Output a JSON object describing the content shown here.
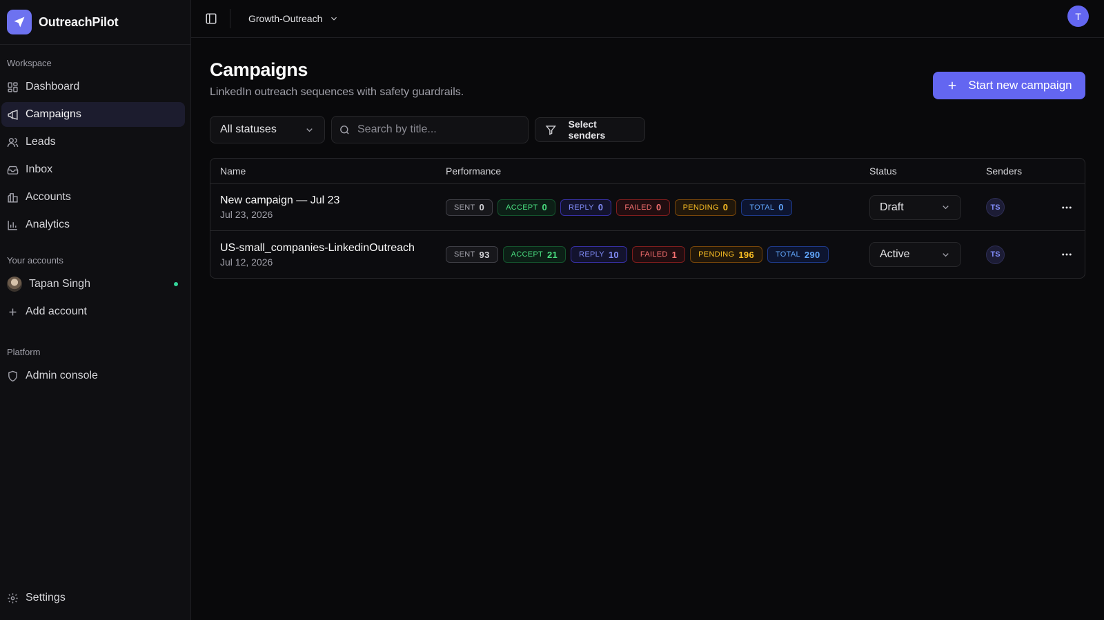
{
  "brand": {
    "name": "OutreachPilot"
  },
  "sidebar": {
    "workspace_label": "Workspace",
    "nav": [
      {
        "label": "Dashboard",
        "icon": "dashboard-icon"
      },
      {
        "label": "Campaigns",
        "icon": "megaphone-icon",
        "active": true
      },
      {
        "label": "Leads",
        "icon": "users-icon"
      },
      {
        "label": "Inbox",
        "icon": "inbox-icon"
      },
      {
        "label": "Accounts",
        "icon": "accounts-icon"
      },
      {
        "label": "Analytics",
        "icon": "bar-chart-icon"
      }
    ],
    "your_accounts_label": "Your accounts",
    "account": {
      "name": "Tapan Singh",
      "status": "online"
    },
    "add_account_label": "Add account",
    "platform_label": "Platform",
    "admin_label": "Admin console",
    "settings_label": "Settings"
  },
  "topbar": {
    "workspace": "Growth-Outreach",
    "user_initial": "T"
  },
  "page": {
    "title": "Campaigns",
    "subtitle": "LinkedIn outreach sequences with safety guardrails.",
    "new_button": "Start new campaign"
  },
  "filters": {
    "status": "All statuses",
    "search_placeholder": "Search by title...",
    "senders_button": "Select senders"
  },
  "table": {
    "headers": {
      "name": "Name",
      "performance": "Performance",
      "status": "Status",
      "senders": "Senders"
    },
    "metric_labels": {
      "sent": "SENT",
      "accept": "ACCEPT",
      "reply": "REPLY",
      "failed": "FAILED",
      "pending": "PENDING",
      "total": "TOTAL"
    },
    "rows": [
      {
        "title": "New campaign — Jul 23",
        "date": "Jul 23, 2026",
        "sent": "0",
        "accept": "0",
        "reply": "0",
        "failed": "0",
        "pending": "0",
        "total": "0",
        "status": "Draft",
        "sender": "TS"
      },
      {
        "title": "US-small_companies-LinkedinOutreach",
        "date": "Jul 12, 2026",
        "sent": "93",
        "accept": "21",
        "reply": "10",
        "failed": "1",
        "pending": "196",
        "total": "290",
        "status": "Active",
        "sender": "TS"
      }
    ]
  },
  "colors": {
    "accent": "#6366f1",
    "background": "#09090b",
    "online": "#34d399"
  }
}
